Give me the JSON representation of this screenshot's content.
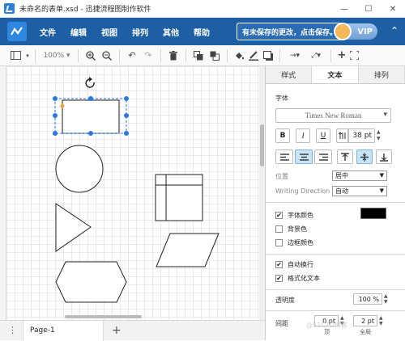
{
  "window": {
    "title": "未命名的表单.xsd - 迅捷流程图制作软件",
    "minimize": "—",
    "maximize": "☐",
    "close": "✕"
  },
  "menu": {
    "items": [
      "文件",
      "编辑",
      "视图",
      "排列",
      "其他",
      "帮助"
    ],
    "save_notice": "有未保存的更改，点击保存。",
    "vip_label": "VIP",
    "collapse": "⌃"
  },
  "toolbar": {
    "zoom": "100%"
  },
  "pages": {
    "current": "Page-1",
    "add": "+",
    "menu": "⋮"
  },
  "panel": {
    "tabs": [
      "样式",
      "文本",
      "排列"
    ],
    "active_tab": "文本",
    "font_section": "字体",
    "font_family": "Times New Roman",
    "font_size": "38 pt",
    "format_buttons": [
      "B",
      "I",
      "U"
    ],
    "position_label": "位置",
    "position_value": "居中",
    "writing_direction_label": "Writing Direction",
    "writing_direction_value": "自动",
    "checkboxes": [
      {
        "label": "字体颜色",
        "checked": true
      },
      {
        "label": "背景色",
        "checked": false
      },
      {
        "label": "边框颜色",
        "checked": false
      }
    ],
    "options": [
      {
        "label": "自动换行",
        "checked": true
      },
      {
        "label": "格式化文本",
        "checked": true
      }
    ],
    "font_color": "#000000",
    "opacity_label": "透明度",
    "opacity_value": "100 %",
    "spacing_label": "间距",
    "spacing_top": "0 pt",
    "spacing_global": "2 pt",
    "spacing_top_caption": "顶",
    "spacing_global_caption": "全局"
  },
  "watermark": "@51CTO博客"
}
